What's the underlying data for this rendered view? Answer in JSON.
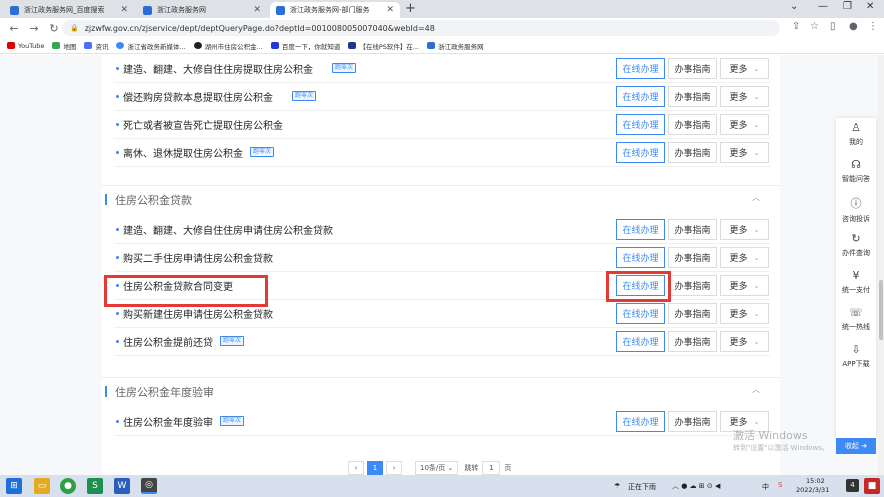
{
  "browser": {
    "tabs": [
      {
        "label": "浙江政务服务网_百度搜索",
        "active": false,
        "favicon_color": "#2b6fd6"
      },
      {
        "label": "浙江政务服务网",
        "active": false,
        "favicon_color": "#2b6fd6"
      },
      {
        "label": "浙江政务服务网-部门服务",
        "active": true,
        "favicon_color": "#2b6fd6"
      }
    ],
    "new_tab": "+",
    "window_controls": [
      "⌄",
      "—",
      "❐",
      "✕"
    ],
    "address": "zjzwfw.gov.cn/zjservice/dept/deptQueryPage.do?deptId=001008005007040&webId=48",
    "bookmarks": [
      {
        "label": "YouTube",
        "icon_color": "#e00000"
      },
      {
        "label": "地图",
        "icon_color": "#34a853"
      },
      {
        "label": "资讯",
        "icon_color": "#4f6ef7"
      },
      {
        "label": "浙江省政务新媒体...",
        "icon_color": "#3d8af7"
      },
      {
        "label": "湖州市住房公积金...",
        "icon_color": "#222"
      },
      {
        "label": "百度一下，你就知道",
        "icon_color": "#2932e1"
      },
      {
        "label": "【在线PS软件】在...",
        "icon_color": "#1a3a8a"
      },
      {
        "label": "浙江政务服务网",
        "icon_color": "#2b6fd6"
      }
    ]
  },
  "buttons": {
    "online": "在线办理",
    "guide": "办事指南",
    "more": "更多"
  },
  "tag_label": "跑零次",
  "group1": {
    "items": [
      {
        "title": "建造、翻建、大修自住住房提取住房公积金",
        "tag": true
      },
      {
        "title": "偿还购房贷款本息提取住房公积金",
        "tag": true
      },
      {
        "title": "死亡或者被宣告死亡提取住房公积金",
        "tag": false
      },
      {
        "title": "离休、退休提取住房公积金",
        "tag": true
      }
    ]
  },
  "group2": {
    "title": "住房公积金贷款",
    "items": [
      {
        "title": "建造、翻建、大修自住住房申请住房公积金贷款",
        "tag": false
      },
      {
        "title": "购买二手住房申请住房公积金贷款",
        "tag": false
      },
      {
        "title": "住房公积金贷款合同变更",
        "tag": false
      },
      {
        "title": "购买新建住房申请住房公积金贷款",
        "tag": false
      },
      {
        "title": "住房公积金提前还贷",
        "tag": true
      }
    ]
  },
  "group3": {
    "title": "住房公积金年度验审",
    "items": [
      {
        "title": "住房公积金年度验审",
        "tag": true
      }
    ]
  },
  "pager": {
    "prev": "‹",
    "current": "1",
    "next": "›",
    "page_size": "10条/页",
    "goto_label": "跳转",
    "goto_value": "1",
    "page_unit": "页"
  },
  "sidebar": [
    {
      "label": "我的",
      "icon": "user-icon",
      "glyph": "♙"
    },
    {
      "label": "智能问答",
      "icon": "headset-icon",
      "glyph": "☊"
    },
    {
      "label": "咨询投诉",
      "icon": "alert-icon",
      "glyph": "ⓘ"
    },
    {
      "label": "办件查询",
      "icon": "history-icon",
      "glyph": "↻"
    },
    {
      "label": "统一支付",
      "icon": "yuan-icon",
      "glyph": "¥"
    },
    {
      "label": "统一热线",
      "icon": "phone-icon",
      "glyph": "☏"
    },
    {
      "label": "APP下载",
      "icon": "download-icon",
      "glyph": "⇩"
    }
  ],
  "collapse_label": "收起",
  "watermark": {
    "line1": "激活 Windows",
    "line2": "转到\"设置\"以激活 Windows。"
  },
  "taskbar": {
    "weather": "正在下雨",
    "ime": "中",
    "time": "15:02",
    "date": "2022/3/31",
    "notify_count": "4"
  },
  "colors": {
    "accent": "#3d8af7",
    "highlight": "#e53935"
  }
}
